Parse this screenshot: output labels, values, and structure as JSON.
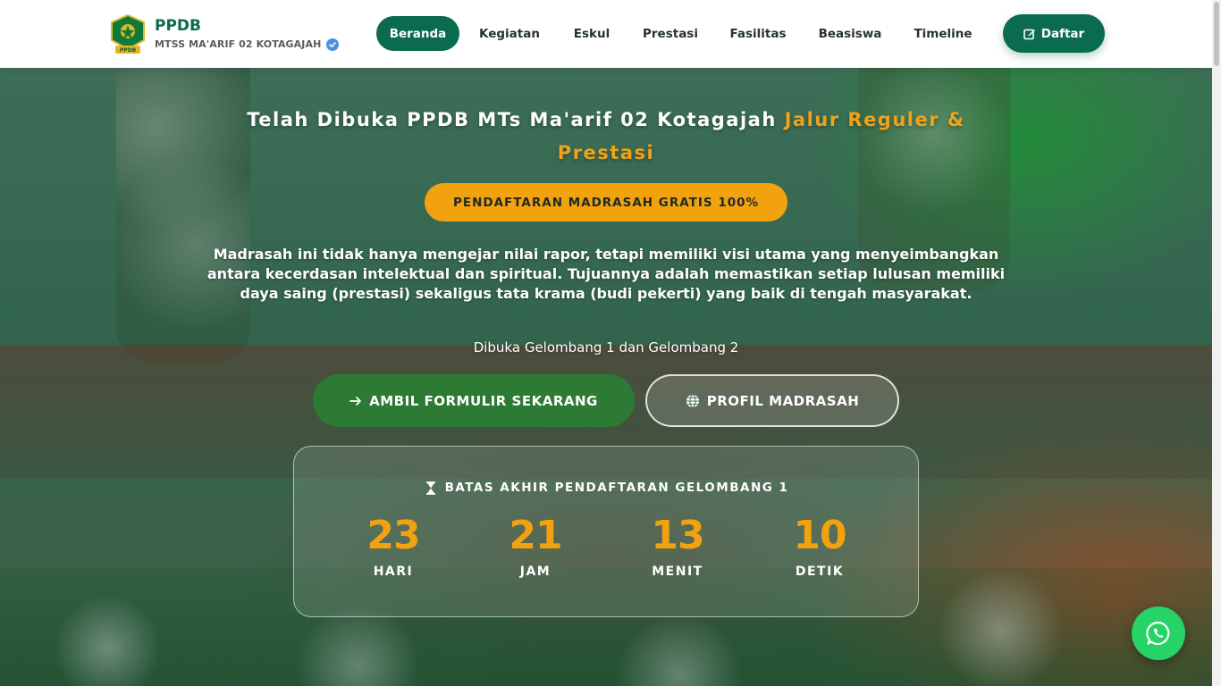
{
  "header": {
    "brand_title": "PPDB",
    "brand_subtitle": "MTSS MA'ARIF 02 KOTAGAJAH",
    "nav": [
      {
        "label": "Beranda",
        "active": true
      },
      {
        "label": "Kegiatan",
        "active": false
      },
      {
        "label": "Eskul",
        "active": false
      },
      {
        "label": "Prestasi",
        "active": false
      },
      {
        "label": "Fasilitas",
        "active": false
      },
      {
        "label": "Beasiswa",
        "active": false
      },
      {
        "label": "Timeline",
        "active": false
      }
    ],
    "daftar_label": "Daftar"
  },
  "hero": {
    "headline_white": "Telah Dibuka PPDB MTs Ma'arif 02 Kotagajah ",
    "headline_accent": "Jalur Reguler & Prestasi",
    "badge": "PENDAFTARAN MADRASAH GRATIS 100%",
    "description": "Madrasah ini tidak hanya mengejar nilai rapor, tetapi memiliki visi utama yang menyeimbangkan antara kecerdasan intelektual dan spiritual. Tujuannya adalah memastikan setiap lulusan memiliki daya saing (prestasi) sekaligus tata krama (budi pekerti) yang baik di tengah masyarakat.",
    "opened": "Dibuka Gelombang 1 dan Gelombang 2",
    "btn_form": "AMBIL FORMULIR SEKARANG",
    "btn_profil": "PROFIL MADRASAH"
  },
  "countdown": {
    "title": "BATAS AKHIR PENDAFTARAN GELOMBANG 1",
    "units": [
      {
        "value": "23",
        "label": "HARI"
      },
      {
        "value": "21",
        "label": "JAM"
      },
      {
        "value": "13",
        "label": "MENIT"
      },
      {
        "value": "10",
        "label": "DETIK"
      }
    ]
  },
  "colors": {
    "primary": "#0b6b4f",
    "accent": "#f2a20f",
    "whatsapp": "#25d366"
  },
  "icons": {
    "logo": "kemenag-logo",
    "verified": "verified-badge-icon",
    "daftar": "edit-icon",
    "form": "arrow-right-icon",
    "profil": "globe-icon",
    "countdown": "hourglass-icon",
    "chat": "whatsapp-icon"
  }
}
